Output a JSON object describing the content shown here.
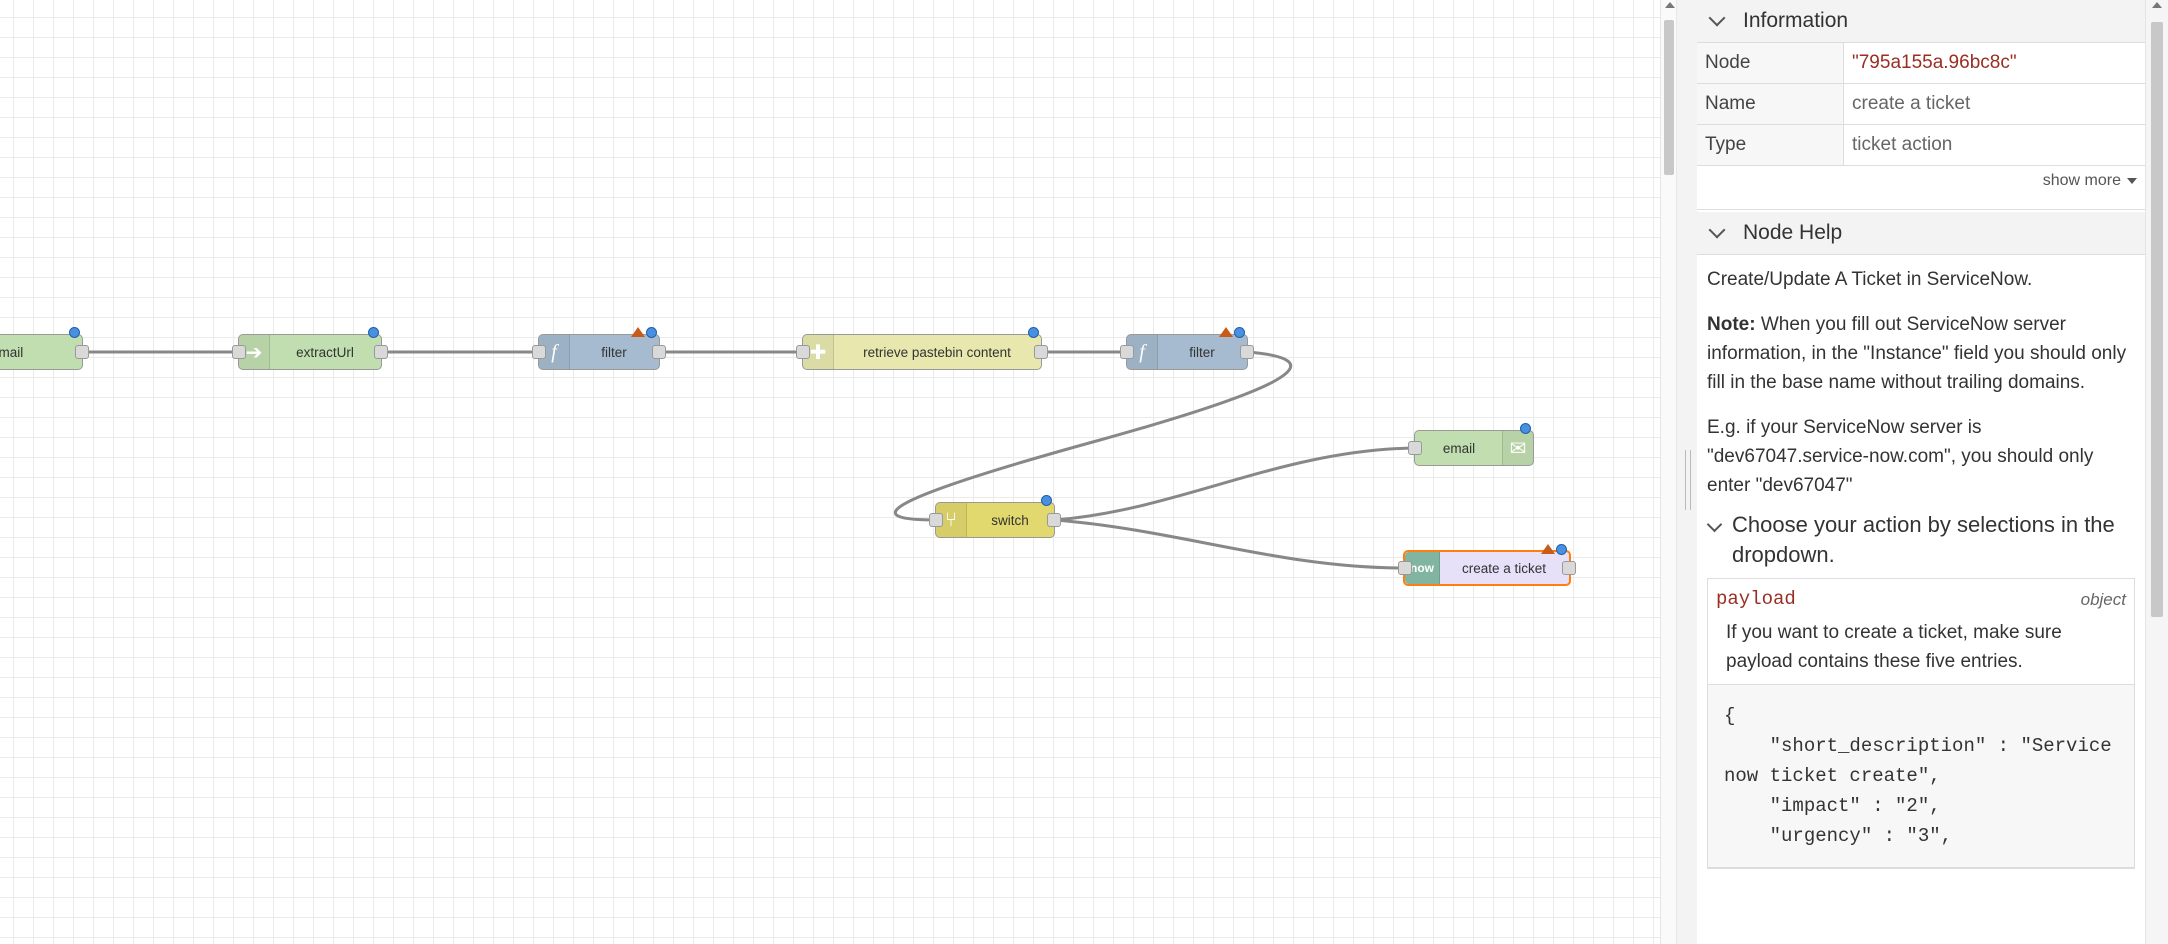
{
  "canvas": {
    "nodes": [
      {
        "id": "email_in",
        "label": "email",
        "color": "#c0deaf",
        "icon": "envelope-icon"
      },
      {
        "id": "extract",
        "label": "extractUrl",
        "color": "#c0deaf",
        "icon": "arrow-right-icon"
      },
      {
        "id": "filter1",
        "label": "filter",
        "color": "#a6bbcf",
        "icon": "function-icon",
        "warning": true
      },
      {
        "id": "pastebin",
        "label": "retrieve pastebin content",
        "color": "#e7e7ae",
        "icon": "puzzle-icon"
      },
      {
        "id": "filter2",
        "label": "filter",
        "color": "#a6bbcf",
        "icon": "function-icon",
        "warning": true
      },
      {
        "id": "switch",
        "label": "switch",
        "color": "#e2d96e",
        "icon": "switch-icon"
      },
      {
        "id": "email_out",
        "label": "email",
        "color": "#c0deaf",
        "icon": "envelope-icon"
      },
      {
        "id": "ticket",
        "label": "create a ticket",
        "color": "#e6e0f8",
        "icon": "servicenow-logo",
        "warning": true,
        "selected": true,
        "icon_text": "now"
      }
    ]
  },
  "sidebar": {
    "info": {
      "title": "Information",
      "rows": [
        {
          "key": "Node",
          "value": "\"795a155a.96bc8c\""
        },
        {
          "key": "Name",
          "value": "create a ticket"
        },
        {
          "key": "Type",
          "value": "ticket action"
        }
      ],
      "show_more": "show more"
    },
    "help": {
      "title": "Node Help",
      "intro": "Create/Update A Ticket in ServiceNow.",
      "note_label": "Note:",
      "note_text": " When you fill out ServiceNow server information, in the \"Instance\" field you should only fill in the base name without trailing domains.",
      "example": "E.g. if your ServiceNow server is \"dev67047.service-now.com\", you should only enter \"dev67047\"",
      "section": "Choose your action by selections in the dropdown.",
      "prop_name": "payload",
      "prop_type": "object",
      "prop_desc": "If you want to create a ticket, make sure payload contains these five entries.",
      "code": "{\n    \"short_description\" : \"Service now ticket create\",\n    \"impact\" : \"2\",\n    \"urgency\" : \"3\","
    }
  }
}
